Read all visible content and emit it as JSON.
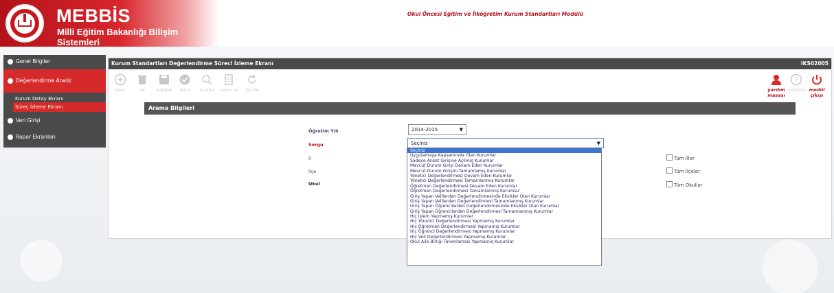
{
  "header": {
    "brand_title": "MEBBİS",
    "brand_subtitle": "Milli Eğitim Bakanlığı Bilişim Sistemleri",
    "module_title": "Okul Öncesi Eğitim ve İlköğretim Kurum Standartları Modülü"
  },
  "sidebar": {
    "items": [
      {
        "label": "Genel Bilgiler"
      },
      {
        "label": "Değerlendirme Analiz"
      },
      {
        "label": "Veri Girişi"
      },
      {
        "label": "Rapor Ekranları"
      }
    ],
    "subitems": [
      {
        "label": "Kurum Detay Ekranı"
      },
      {
        "label": "Süreç İzleme Ekranı"
      }
    ]
  },
  "panel": {
    "title": "Kurum Standartları Değerlendirme Süreci İzleme Ekranı",
    "screen_code": "IKS02005"
  },
  "toolbar": {
    "yeni": "yeni",
    "sil": "sil",
    "kaydet": "kaydet",
    "iptal": "iptal",
    "arama": "arama",
    "rapor_al": "rapor al",
    "yenile": "yenile",
    "yardim_masasi": "yardım masası",
    "yardim": "yardım",
    "modul_cikisi": "modül çıkışı"
  },
  "search": {
    "section_title": "Arama Bilgileri",
    "ogretim_yili_label": "Öğretim Yılı",
    "ogretim_yili_value": "2014-2015",
    "sorgu_label": "Sorgu",
    "sorgu_value": "Seçiniz",
    "il_label": "İl",
    "ilce_label": "İlçe",
    "okul_label": "Okul",
    "tum_iller": "Tüm İller",
    "tum_ilceler": "Tüm İlçeler",
    "tum_okullar": "Tüm Okullar"
  },
  "dropdown_options": [
    "Seçiniz",
    "Uygulamaya Kapsamında Olan Kurumlar",
    "Sadece Anket Girişine Açılmış Kurumlar",
    "Mevcut Durum Girişi Devam Eden Kurumlar",
    "Mevcut Durum Girişini Tamamlamış Kurumlar",
    "Yönetici Değerlendirmesi Devam Eden Kurumlar",
    "Yönetici Değerlendirmesi Tamamlanmış Kurumlar",
    "Öğretmen Değerlendirmesi Devam Eden Kurumlar",
    "Öğretmen Değerlendirmesi Tamamlanmış Kurumlar",
    "Giriş Yapan Velilerden Değerlendirmesinde Eksikler Olan Kurumlar",
    "Giriş Yapan Velilerden Değerlendirmesi Tamamlanmış Kurumlar",
    "Giriş Yapan Öğrencilerden Değerlendirmesinde Eksikler Olan Kurumlar",
    "Giriş Yapan Öğrencilerden Değerlendirmesi Tamamlanmış Kurumlar",
    "Hiç İşlem Yapmamış Kurumlar",
    "Hiç Yönetici Değerlendirmesi Yapmamış Kurumlar",
    "Hiç Öğretmen Değerlendirmesi Yapmamış Kurumlar",
    "Hiç Öğrenci Değerlendirmesi Yapmamış Kurumlar",
    "Hiç Veli Değerlendirmesi Yapmamış Kurumlar",
    "Okul Aile Birliği Tanımlaması Yapmamış Kurumlar"
  ],
  "colors": {
    "brand_red": "#d62a2a",
    "dark_bar": "#4a4a4a",
    "selected_blue": "#3b76d0"
  }
}
